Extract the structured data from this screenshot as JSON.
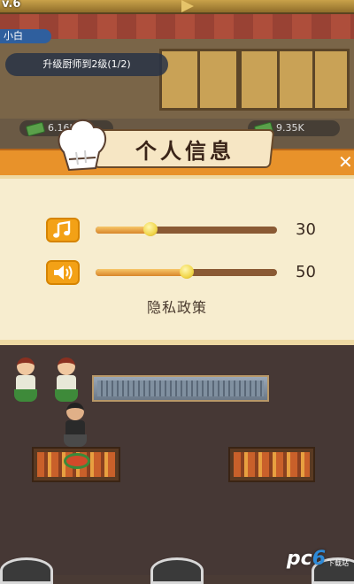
{
  "game": {
    "level_label": "v.6",
    "player_name": "小白",
    "task_text": "升级厨师到2级(1/2)",
    "money_left": "6.16K",
    "money_right": "9.35K"
  },
  "dialog": {
    "title": "个人信息",
    "close_symbol": "✕",
    "music": {
      "icon": "music-note-icon",
      "value": 30,
      "value_label": "30"
    },
    "sound": {
      "icon": "speaker-icon",
      "value": 50,
      "value_label": "50"
    },
    "privacy_label": "隐私政策"
  },
  "watermark": {
    "brand_pc": "pc",
    "brand_six": "6",
    "sub": "下载站"
  },
  "colors": {
    "accent_orange": "#f3a116",
    "banner_orange": "#e8922a",
    "panel_cream": "#f7edcf",
    "track_brown": "#8a5a34"
  }
}
